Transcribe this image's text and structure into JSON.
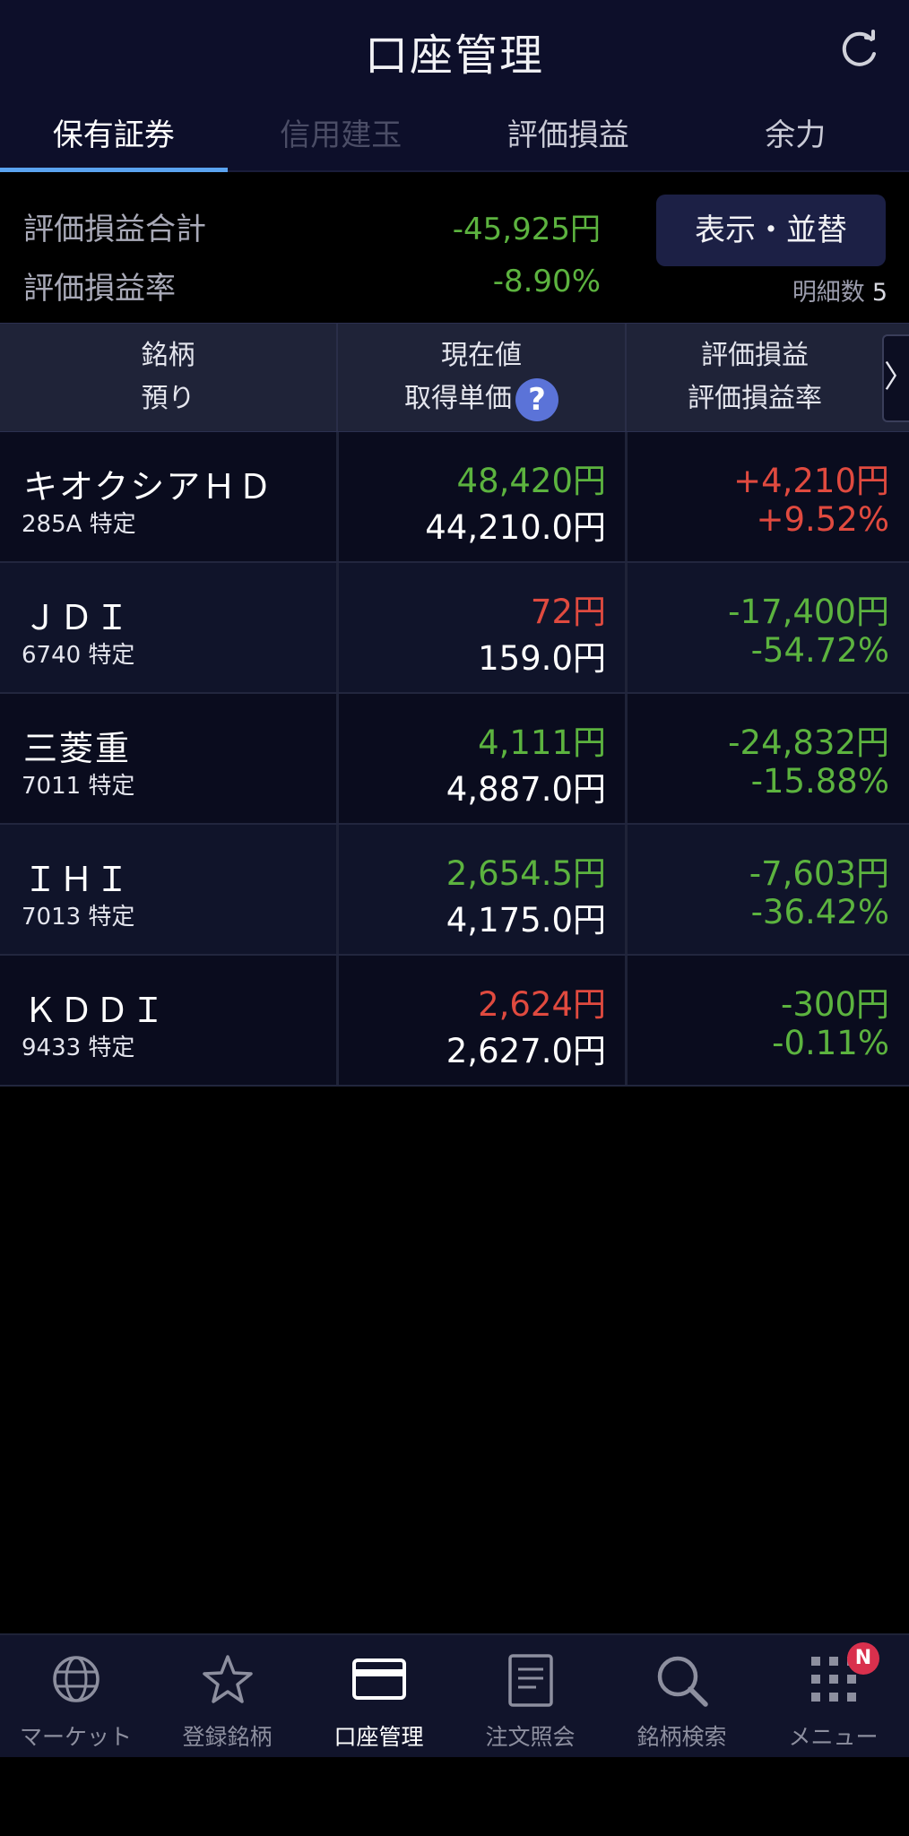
{
  "header": {
    "title": "口座管理",
    "refresh_icon": "refresh-icon"
  },
  "tabs": [
    {
      "label": "保有証券",
      "state": "active"
    },
    {
      "label": "信用建玉",
      "state": "disabled"
    },
    {
      "label": "評価損益",
      "state": "normal"
    },
    {
      "label": "余力",
      "state": "normal"
    }
  ],
  "summary": {
    "total_label": "評価損益合計",
    "total_value": "-45,925円",
    "rate_label": "評価損益率",
    "rate_value": "-8.90%",
    "sort_button": "表示・並替",
    "count_label": "明細数",
    "count_value": "5"
  },
  "table_header": {
    "col1_line1": "銘柄",
    "col1_line2": "預り",
    "col2_line1": "現在値",
    "col2_line2": "取得単価",
    "help_icon": "?",
    "col3_line1": "評価損益",
    "col3_line2": "評価損益率",
    "next_arrow": "〉"
  },
  "rows": [
    {
      "name": "キオクシアＨＤ",
      "code": "285A 特定",
      "price": "48,420円",
      "price_color": "green",
      "cost": "44,210.0円",
      "pl": "+4,210円",
      "rate": "+9.52%",
      "pl_color": "red"
    },
    {
      "name": "ＪＤＩ",
      "code": "6740 特定",
      "price": "72円",
      "price_color": "red",
      "cost": "159.0円",
      "pl": "-17,400円",
      "rate": "-54.72%",
      "pl_color": "green"
    },
    {
      "name": "三菱重",
      "code": "7011 特定",
      "price": "4,111円",
      "price_color": "green",
      "cost": "4,887.0円",
      "pl": "-24,832円",
      "rate": "-15.88%",
      "pl_color": "green"
    },
    {
      "name": "ＩＨＩ",
      "code": "7013 特定",
      "price": "2,654.5円",
      "price_color": "green",
      "cost": "4,175.0円",
      "pl": "-7,603円",
      "rate": "-36.42%",
      "pl_color": "green"
    },
    {
      "name": "ＫＤＤＩ",
      "code": "9433 特定",
      "price": "2,624円",
      "price_color": "red",
      "cost": "2,627.0円",
      "pl": "-300円",
      "rate": "-0.11%",
      "pl_color": "green"
    }
  ],
  "bottom_nav": [
    {
      "label": "マーケット",
      "icon": "globe-icon"
    },
    {
      "label": "登録銘柄",
      "icon": "star-icon"
    },
    {
      "label": "口座管理",
      "icon": "card-icon",
      "active": true
    },
    {
      "label": "注文照会",
      "icon": "document-icon"
    },
    {
      "label": "銘柄検索",
      "icon": "search-icon"
    },
    {
      "label": "メニュー",
      "icon": "grid-icon",
      "badge": "N"
    }
  ],
  "colors": {
    "positive": "#e04a3f",
    "negative": "#5cb33f",
    "accent": "#5aa3f0"
  }
}
